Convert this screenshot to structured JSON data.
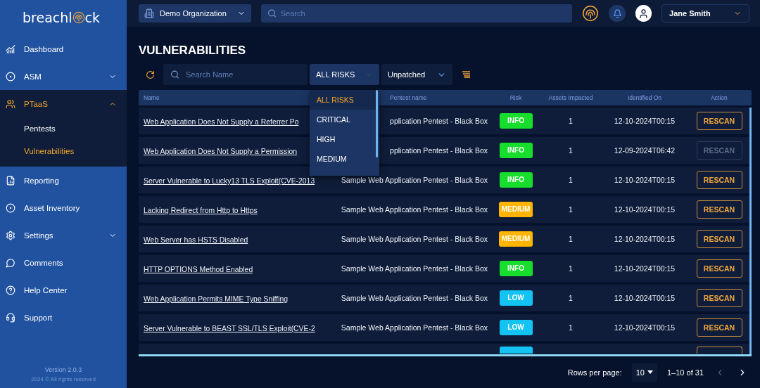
{
  "sidebar": {
    "logo": {
      "before": "breachl",
      "after": "ck"
    },
    "items": [
      {
        "label": "Dashboard",
        "selected": false
      },
      {
        "label": "ASM",
        "selected": false,
        "expanded": false
      },
      {
        "label": "PTaaS",
        "selected": true,
        "expanded": true,
        "children": [
          {
            "label": "Pentests",
            "selected": false
          },
          {
            "label": "Vulnerabilities",
            "selected": true
          }
        ]
      },
      {
        "label": "Reporting",
        "selected": false
      },
      {
        "label": "Asset Inventory",
        "selected": false
      },
      {
        "label": "Settings",
        "selected": false,
        "expanded": false
      },
      {
        "label": "Comments",
        "selected": false
      },
      {
        "label": "Help Center",
        "selected": false
      },
      {
        "label": "Support",
        "selected": false
      }
    ],
    "version": "Version 2.0.3",
    "copyright": "2024 © All rights reserved"
  },
  "topbar": {
    "organization": "Demo Organization",
    "search": {
      "placeholder": "Search"
    },
    "user": "Jane Smith"
  },
  "page_title": "VULNERABILITIES",
  "filters": {
    "search": {
      "placeholder": "Search Name"
    },
    "risk": {
      "value": "ALL RISKS",
      "expanded": true,
      "options": [
        {
          "label": "ALL RISKS",
          "selected": true
        },
        {
          "label": "CRITICAL",
          "selected": false
        },
        {
          "label": "HIGH",
          "selected": false
        },
        {
          "label": "MEDIUM",
          "selected": false
        }
      ]
    },
    "status": {
      "value": "Unpatched"
    }
  },
  "table": {
    "columns": [
      "Name",
      "Pentest name",
      "Risk",
      "Assets Impacted",
      "Identified On",
      "Action"
    ],
    "rows": [
      {
        "name": "Web Application Does Not Supply a Referrer Po",
        "pentest": "pplication Pentest - Black Box",
        "risk": "INFO",
        "color": "#17dd2c",
        "assets": "1",
        "identified": "12-10-2024T00:15",
        "action": "RESCAN",
        "disabled": false
      },
      {
        "name": "Web Application Does Not Supply a Permission",
        "pentest": "pplication Pentest - Black Box",
        "risk": "INFO",
        "color": "#17dd2c",
        "assets": "1",
        "identified": "12-09-2024T06:42",
        "action": "RESCAN",
        "disabled": true
      },
      {
        "name": "Server Vulnerable to Lucky13 TLS Exploit(CVE-2013",
        "pentest": "Sample Web Application Pentest - Black Box",
        "risk": "INFO",
        "color": "#17dd2c",
        "assets": "1",
        "identified": "12-10-2024T00:15",
        "action": "RESCAN",
        "disabled": false
      },
      {
        "name": "Lacking Redirect from Http to Https",
        "pentest": "Sample Web Application Pentest - Black Box",
        "risk": "MEDIUM",
        "color": "#ffb400",
        "assets": "1",
        "identified": "12-10-2024T00:15",
        "action": "RESCAN",
        "disabled": false
      },
      {
        "name": "Web Server has HSTS Disabled",
        "pentest": "Sample Web Application Pentest - Black Box",
        "risk": "MEDIUM",
        "color": "#ffb400",
        "assets": "1",
        "identified": "12-10-2024T00:15",
        "action": "RESCAN",
        "disabled": false
      },
      {
        "name": "HTTP OPTIONS Method Enabled",
        "pentest": "Sample Web Application Pentest - Black Box",
        "risk": "INFO",
        "color": "#17dd2c",
        "assets": "1",
        "identified": "12-10-2024T00:15",
        "action": "RESCAN",
        "disabled": false
      },
      {
        "name": "Web Application Permits MIME Type Sniffing",
        "pentest": "Sample Web Application Pentest - Black Box",
        "risk": "LOW",
        "color": "#13c3f3",
        "assets": "1",
        "identified": "12-10-2024T00:15",
        "action": "RESCAN",
        "disabled": false
      },
      {
        "name": "Server Vulnerable to BEAST SSL/TLS Exploit(CVE-2",
        "pentest": "Sample Web Application Pentest - Black Box",
        "risk": "LOW",
        "color": "#13c3f3",
        "assets": "1",
        "identified": "12-10-2024T00:15",
        "action": "RESCAN",
        "disabled": false
      }
    ],
    "clipped_row": {
      "color": "#13c3f3"
    }
  },
  "pagination": {
    "label": "Rows per page:",
    "rows_per_page": "10",
    "range": "1–10 of 31",
    "prev_disabled": true,
    "next_disabled": false
  }
}
